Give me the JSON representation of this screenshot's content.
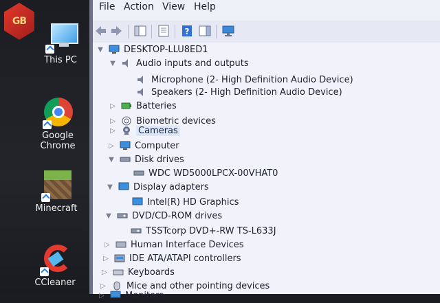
{
  "desktop": {
    "logo": "GB",
    "icons": [
      {
        "label": "This PC"
      },
      {
        "label": "Google Chrome"
      },
      {
        "label": "Minecraft"
      },
      {
        "label": "CCleaner"
      }
    ]
  },
  "menu": [
    "File",
    "Action",
    "View",
    "Help"
  ],
  "tree": {
    "root": "DESKTOP-LLU8ED1",
    "audio": {
      "label": "Audio inputs and outputs",
      "children": [
        "Microphone (2- High Definition Audio Device)",
        "Speakers (2- High Definition Audio Device)"
      ]
    },
    "batteries": "Batteries",
    "biometric": "Biometric devices",
    "cameras": "Cameras",
    "computer": "Computer",
    "disk": {
      "label": "Disk drives",
      "children": [
        "WDC WD5000LPCX-00VHAT0"
      ]
    },
    "display": {
      "label": "Display adapters",
      "children": [
        "Intel(R) HD Graphics"
      ]
    },
    "dvd": {
      "label": "DVD/CD-ROM drives",
      "children": [
        "TSSTcorp DVD+-RW TS-L633J"
      ]
    },
    "hid": "Human Interface Devices",
    "ide": "IDE ATA/ATAPI controllers",
    "keyboards": "Keyboards",
    "mice": "Mice and other pointing devices",
    "monitors": "Monitors"
  }
}
